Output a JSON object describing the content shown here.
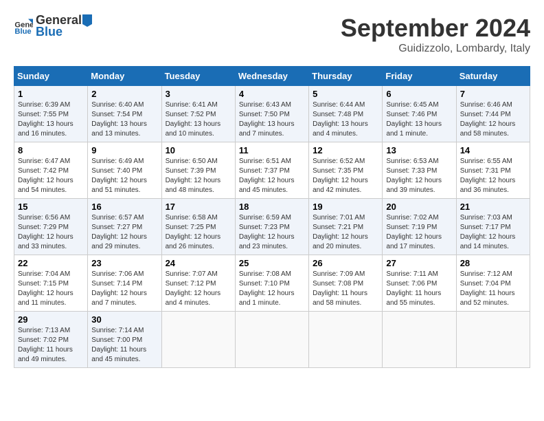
{
  "header": {
    "logo_general": "General",
    "logo_blue": "Blue",
    "month_title": "September 2024",
    "location": "Guidizzolo, Lombardy, Italy"
  },
  "weekdays": [
    "Sunday",
    "Monday",
    "Tuesday",
    "Wednesday",
    "Thursday",
    "Friday",
    "Saturday"
  ],
  "weeks": [
    [
      {
        "day": "1",
        "info": "Sunrise: 6:39 AM\nSunset: 7:55 PM\nDaylight: 13 hours and 16 minutes."
      },
      {
        "day": "2",
        "info": "Sunrise: 6:40 AM\nSunset: 7:54 PM\nDaylight: 13 hours and 13 minutes."
      },
      {
        "day": "3",
        "info": "Sunrise: 6:41 AM\nSunset: 7:52 PM\nDaylight: 13 hours and 10 minutes."
      },
      {
        "day": "4",
        "info": "Sunrise: 6:43 AM\nSunset: 7:50 PM\nDaylight: 13 hours and 7 minutes."
      },
      {
        "day": "5",
        "info": "Sunrise: 6:44 AM\nSunset: 7:48 PM\nDaylight: 13 hours and 4 minutes."
      },
      {
        "day": "6",
        "info": "Sunrise: 6:45 AM\nSunset: 7:46 PM\nDaylight: 13 hours and 1 minute."
      },
      {
        "day": "7",
        "info": "Sunrise: 6:46 AM\nSunset: 7:44 PM\nDaylight: 12 hours and 58 minutes."
      }
    ],
    [
      {
        "day": "8",
        "info": "Sunrise: 6:47 AM\nSunset: 7:42 PM\nDaylight: 12 hours and 54 minutes."
      },
      {
        "day": "9",
        "info": "Sunrise: 6:49 AM\nSunset: 7:40 PM\nDaylight: 12 hours and 51 minutes."
      },
      {
        "day": "10",
        "info": "Sunrise: 6:50 AM\nSunset: 7:39 PM\nDaylight: 12 hours and 48 minutes."
      },
      {
        "day": "11",
        "info": "Sunrise: 6:51 AM\nSunset: 7:37 PM\nDaylight: 12 hours and 45 minutes."
      },
      {
        "day": "12",
        "info": "Sunrise: 6:52 AM\nSunset: 7:35 PM\nDaylight: 12 hours and 42 minutes."
      },
      {
        "day": "13",
        "info": "Sunrise: 6:53 AM\nSunset: 7:33 PM\nDaylight: 12 hours and 39 minutes."
      },
      {
        "day": "14",
        "info": "Sunrise: 6:55 AM\nSunset: 7:31 PM\nDaylight: 12 hours and 36 minutes."
      }
    ],
    [
      {
        "day": "15",
        "info": "Sunrise: 6:56 AM\nSunset: 7:29 PM\nDaylight: 12 hours and 33 minutes."
      },
      {
        "day": "16",
        "info": "Sunrise: 6:57 AM\nSunset: 7:27 PM\nDaylight: 12 hours and 29 minutes."
      },
      {
        "day": "17",
        "info": "Sunrise: 6:58 AM\nSunset: 7:25 PM\nDaylight: 12 hours and 26 minutes."
      },
      {
        "day": "18",
        "info": "Sunrise: 6:59 AM\nSunset: 7:23 PM\nDaylight: 12 hours and 23 minutes."
      },
      {
        "day": "19",
        "info": "Sunrise: 7:01 AM\nSunset: 7:21 PM\nDaylight: 12 hours and 20 minutes."
      },
      {
        "day": "20",
        "info": "Sunrise: 7:02 AM\nSunset: 7:19 PM\nDaylight: 12 hours and 17 minutes."
      },
      {
        "day": "21",
        "info": "Sunrise: 7:03 AM\nSunset: 7:17 PM\nDaylight: 12 hours and 14 minutes."
      }
    ],
    [
      {
        "day": "22",
        "info": "Sunrise: 7:04 AM\nSunset: 7:15 PM\nDaylight: 12 hours and 11 minutes."
      },
      {
        "day": "23",
        "info": "Sunrise: 7:06 AM\nSunset: 7:14 PM\nDaylight: 12 hours and 7 minutes."
      },
      {
        "day": "24",
        "info": "Sunrise: 7:07 AM\nSunset: 7:12 PM\nDaylight: 12 hours and 4 minutes."
      },
      {
        "day": "25",
        "info": "Sunrise: 7:08 AM\nSunset: 7:10 PM\nDaylight: 12 hours and 1 minute."
      },
      {
        "day": "26",
        "info": "Sunrise: 7:09 AM\nSunset: 7:08 PM\nDaylight: 11 hours and 58 minutes."
      },
      {
        "day": "27",
        "info": "Sunrise: 7:11 AM\nSunset: 7:06 PM\nDaylight: 11 hours and 55 minutes."
      },
      {
        "day": "28",
        "info": "Sunrise: 7:12 AM\nSunset: 7:04 PM\nDaylight: 11 hours and 52 minutes."
      }
    ],
    [
      {
        "day": "29",
        "info": "Sunrise: 7:13 AM\nSunset: 7:02 PM\nDaylight: 11 hours and 49 minutes."
      },
      {
        "day": "30",
        "info": "Sunrise: 7:14 AM\nSunset: 7:00 PM\nDaylight: 11 hours and 45 minutes."
      },
      {
        "day": "",
        "info": ""
      },
      {
        "day": "",
        "info": ""
      },
      {
        "day": "",
        "info": ""
      },
      {
        "day": "",
        "info": ""
      },
      {
        "day": "",
        "info": ""
      }
    ]
  ]
}
